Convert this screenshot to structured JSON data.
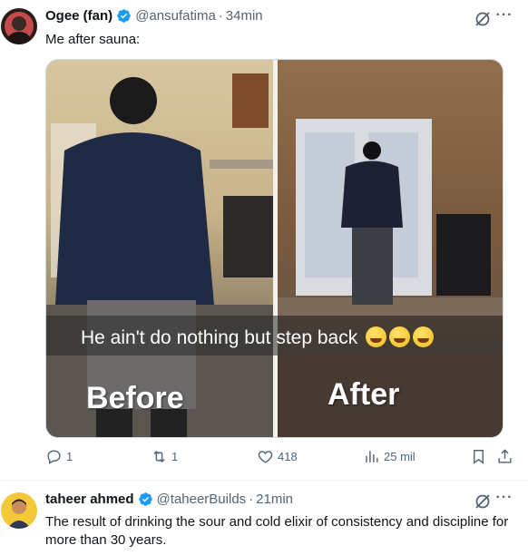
{
  "tweet1": {
    "display_name": "Ogee (fan)",
    "handle": "@ansufatima",
    "separator": "·",
    "time": "34min",
    "text": "Me after sauna:",
    "media": {
      "caption": "He ain't do nothing but step back",
      "emoji_count": 3,
      "before_label": "Before",
      "after_label": "After"
    },
    "actions": {
      "replies": "1",
      "retweets": "1",
      "likes": "418",
      "views": "25 mil"
    }
  },
  "tweet2": {
    "display_name": "taheer ahmed",
    "handle": "@taheerBuilds",
    "separator": "·",
    "time": "21min",
    "text": "The result of drinking the sour and cold elixir of consistency and discipline for more than 30 years."
  },
  "colors": {
    "verified": "#1d9bf0",
    "muted": "#536471",
    "text": "#0f1419",
    "divider": "#eff3f4"
  },
  "icons": [
    "verified-badge-icon",
    "grok-icon",
    "more-icon",
    "reply-icon",
    "retweet-icon",
    "like-icon",
    "views-icon",
    "bookmark-icon",
    "share-icon"
  ]
}
